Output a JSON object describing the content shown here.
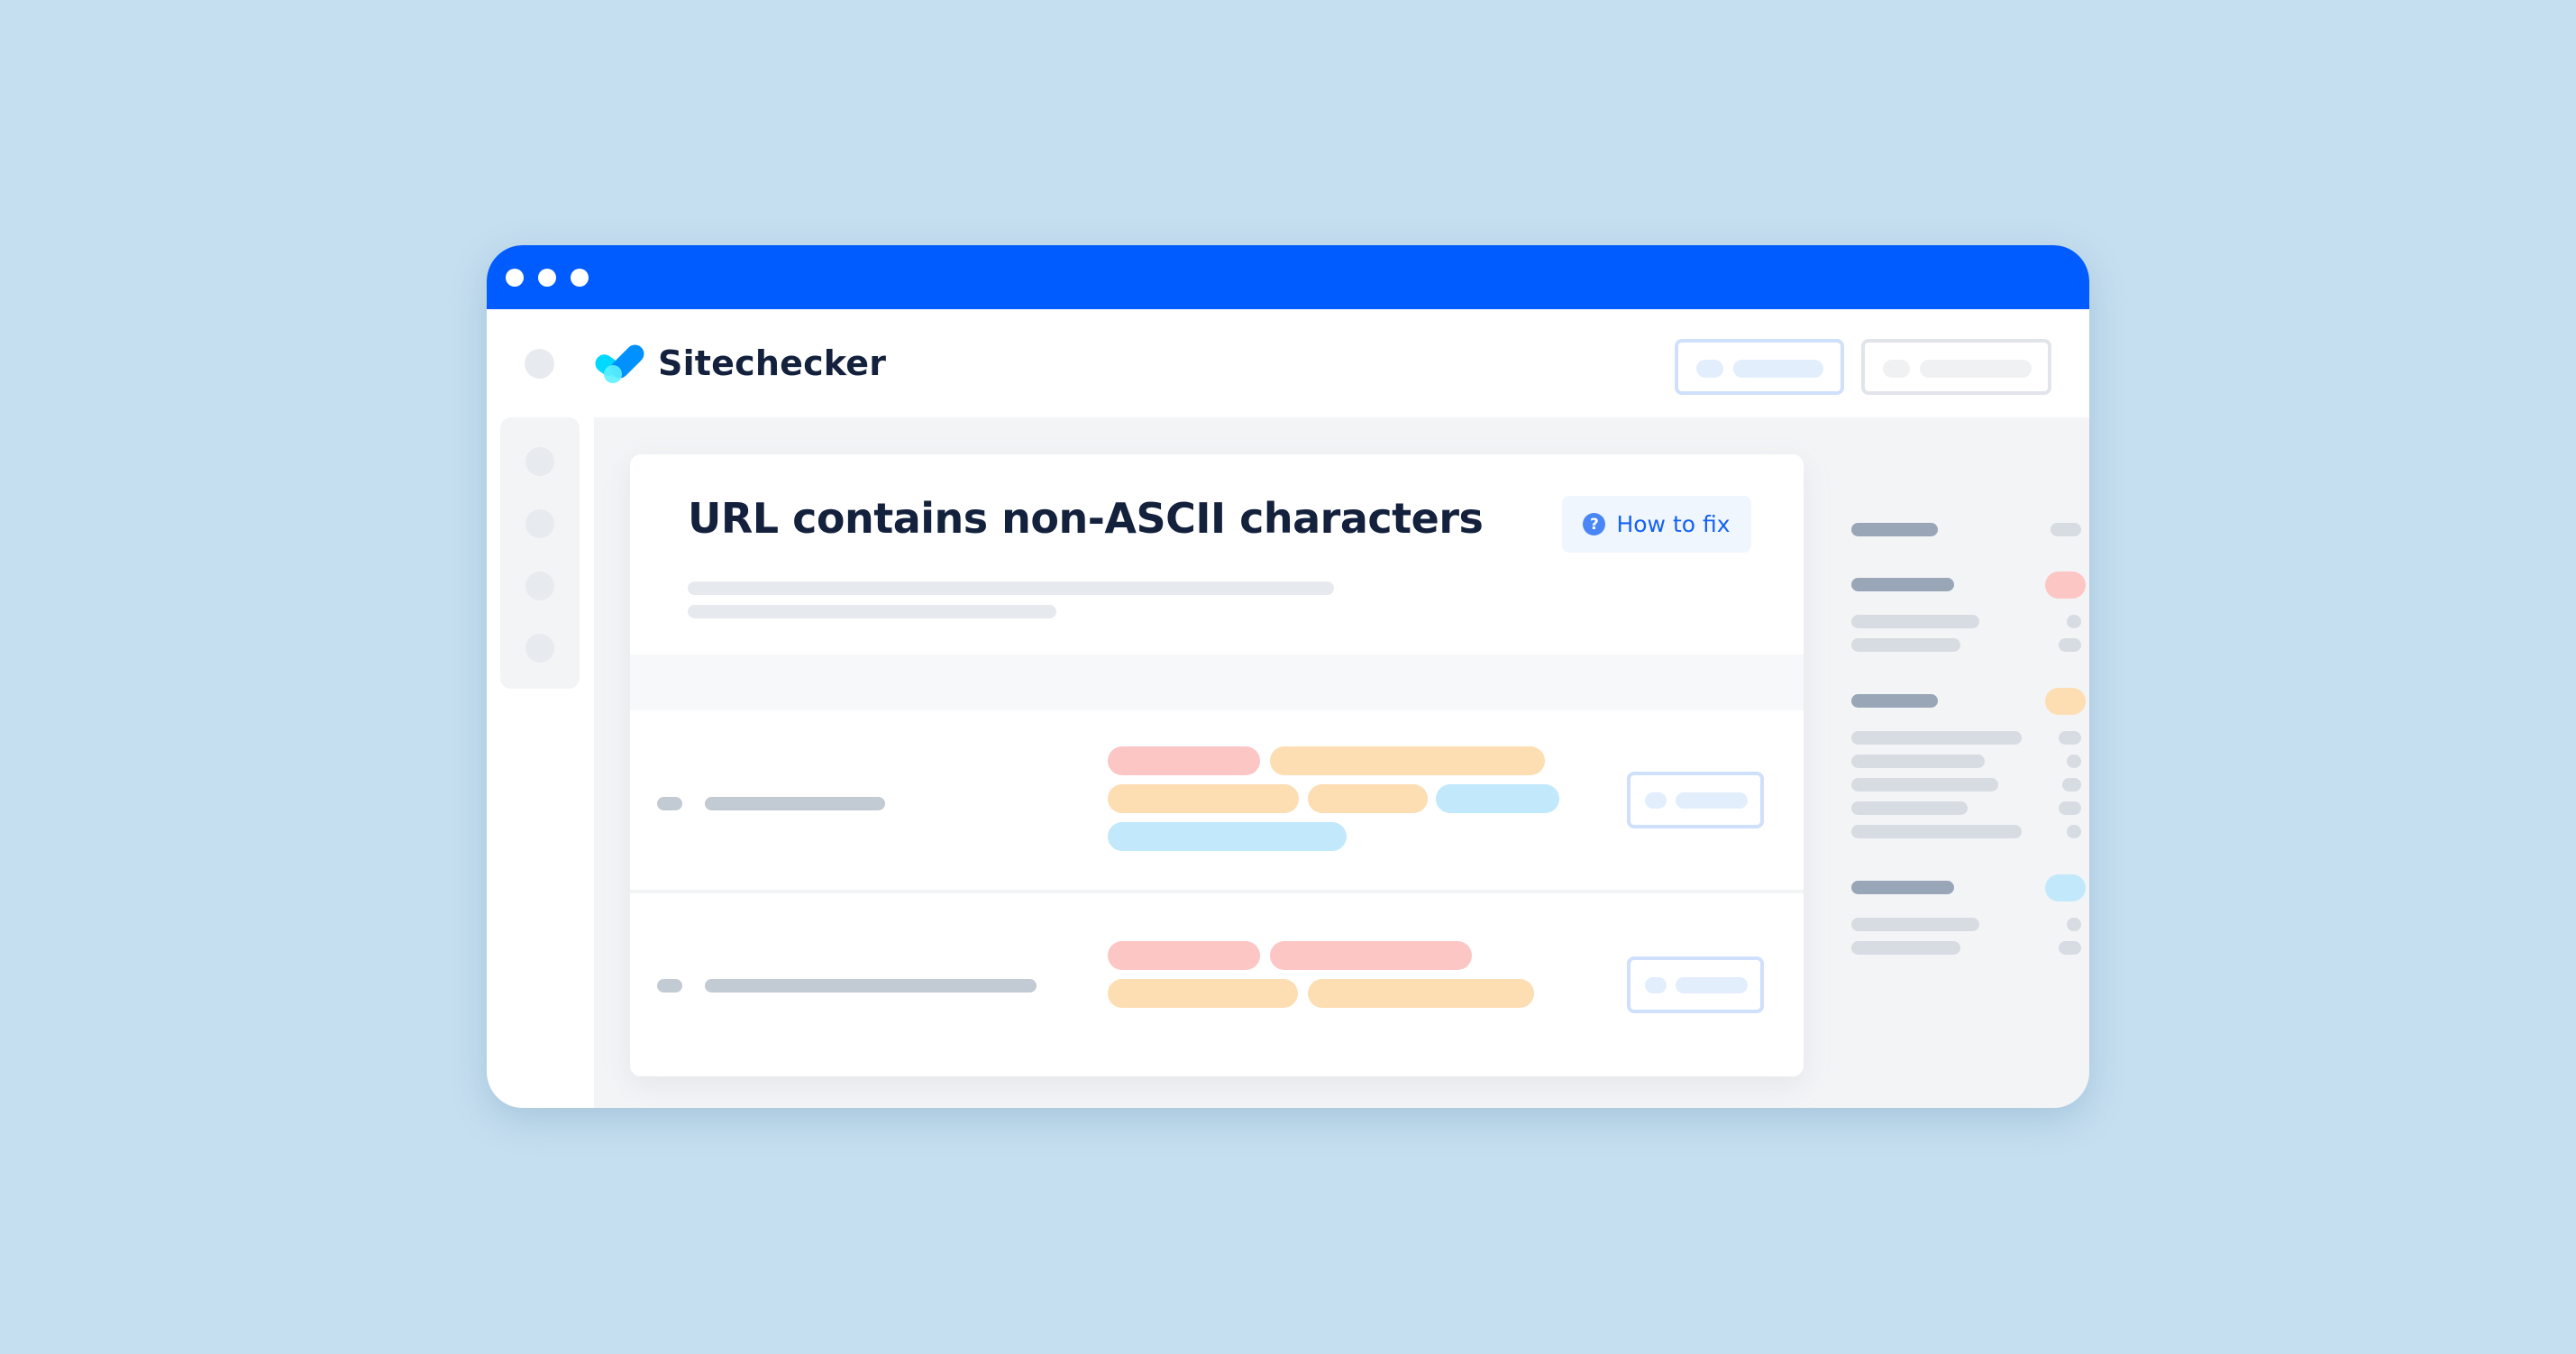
{
  "window": {
    "titlebar_color": "#005CFF",
    "controls": [
      "dot",
      "dot",
      "dot"
    ]
  },
  "header": {
    "brand": "Sitechecker",
    "logo_icon": "checkmark-logo-icon",
    "buttons": [
      {
        "style": "primary-outline"
      },
      {
        "style": "secondary-outline"
      }
    ]
  },
  "sidebar": {
    "items": [
      {
        "icon": "nav-icon"
      },
      {
        "icon": "nav-icon"
      },
      {
        "icon": "nav-icon"
      },
      {
        "icon": "nav-icon"
      }
    ]
  },
  "issue": {
    "title": "URL contains non-ASCII characters",
    "how_to_fix_label": "How to fix",
    "how_to_fix_icon": "question-circle-icon",
    "how_to_fix_icon_glyph": "?"
  },
  "table": {
    "rows": [
      {
        "tags": [
          "red",
          "orange",
          "orange",
          "orange",
          "blue",
          "blue"
        ]
      },
      {
        "tags": [
          "red",
          "red",
          "orange",
          "orange"
        ]
      }
    ]
  },
  "summary_panel": {
    "groups": [
      {
        "status": "neutral",
        "items": 0
      },
      {
        "status": "error",
        "status_color": "#FBC6C3",
        "items": 2
      },
      {
        "status": "warning",
        "status_color": "#FDDDB2",
        "items": 5
      },
      {
        "status": "info",
        "status_color": "#C1E8FB",
        "items": 2
      }
    ]
  },
  "colors": {
    "background": "#C5DFF0",
    "accent": "#005CFF",
    "title_text": "#14213D",
    "link": "#1462F5",
    "error": "#FBC6C3",
    "warning": "#FDDDB2",
    "info": "#C1E8FB"
  }
}
